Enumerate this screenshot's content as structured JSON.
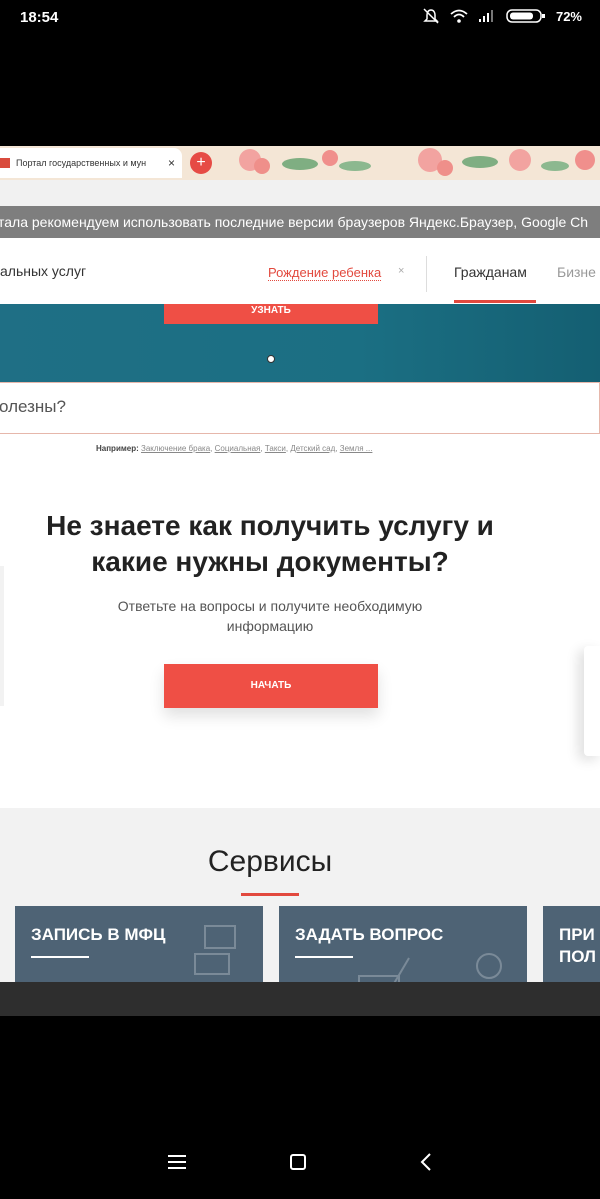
{
  "status_bar": {
    "time": "18:54",
    "battery": "72%"
  },
  "browser": {
    "tab_title": "Портал государственных и мун",
    "tab_close": "×",
    "new_tab": "+"
  },
  "notice": {
    "text": "тала рекомендуем использовать последние версии браузеров Яндекс.Браузер, Google Ch"
  },
  "nav": {
    "left_text": "альных услуг",
    "pill_label": "Рождение ребенка",
    "pill_close": "×",
    "citizens": "Гражданам",
    "business": "Бизне"
  },
  "hero": {
    "button_label": "УЗНАТЬ"
  },
  "search": {
    "placeholder": "олезны?"
  },
  "examples": {
    "prefix": "Например:",
    "items": [
      "Заключение брака",
      "Социальная",
      "Такси",
      "Детский сад",
      "Земля ..."
    ]
  },
  "promo": {
    "headline_line1": "Не знаете как получить услугу и",
    "headline_line2": "какие нужны документы?",
    "subtext_line1": "Ответьте на вопросы и получите необходимую",
    "subtext_line2": "информацию",
    "start_button": "НАЧАТЬ"
  },
  "services": {
    "title": "Сервисы",
    "cards": [
      {
        "title": "ЗАПИСЬ В МФЦ"
      },
      {
        "title": "ЗАДАТЬ ВОПРОС"
      },
      {
        "title_line1": "ПРИ",
        "title_line2": "ПОЛ"
      }
    ]
  },
  "colors": {
    "accent": "#ef4f45",
    "hero_bg": "#1f6f85",
    "card_bg": "#4e6375"
  }
}
